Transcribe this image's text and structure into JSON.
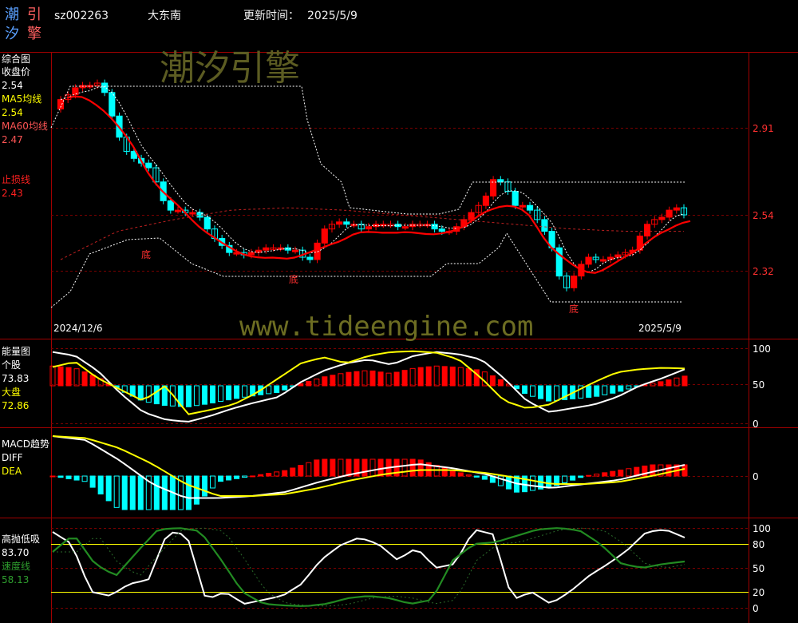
{
  "header": {
    "logo_chars": [
      "潮",
      "引",
      "汐",
      "擎"
    ],
    "code": "sz002263",
    "name": "大东南",
    "update_label": "更新时间：",
    "update_date": "2025/5/9"
  },
  "watermarks": {
    "brand": "潮汐引擎",
    "site": "www.tideengine.com"
  },
  "colors": {
    "up": "#ff0000",
    "down": "#00ffff",
    "ma5": "#ffff00",
    "ma60": "#ff0000",
    "grid": "#8b0000",
    "frame": "#a00000",
    "green": "#228b22"
  },
  "chart_data": [
    {
      "type": "candlestick",
      "title": "综合图",
      "legend": [
        {
          "label": "收盘价",
          "value": "2.54",
          "color": "#ffffff"
        },
        {
          "label": "MA5均线",
          "value": "2.54",
          "color": "#ffff00"
        },
        {
          "label": "MA60均线",
          "value": "2.47",
          "color": "#ff5555"
        },
        {
          "label": "止损线",
          "value": "2.43",
          "color": "#ff2020"
        }
      ],
      "y_ticks": [
        2.91,
        2.54,
        2.32
      ],
      "x_labels": {
        "start": "2024/12/6",
        "end": "2025/5/9"
      },
      "annotations": [
        "底",
        "底",
        "底"
      ],
      "ohlc_close": [
        3.03,
        3.05,
        3.08,
        3.09,
        3.09,
        3.1,
        3.06,
        2.96,
        2.87,
        2.81,
        2.78,
        2.76,
        2.74,
        2.68,
        2.6,
        2.56,
        2.56,
        2.55,
        2.55,
        2.53,
        2.48,
        2.44,
        2.41,
        2.38,
        2.38,
        2.37,
        2.38,
        2.39,
        2.4,
        2.4,
        2.4,
        2.39,
        2.39,
        2.36,
        2.35,
        2.42,
        2.48,
        2.5,
        2.51,
        2.5,
        2.5,
        2.48,
        2.49,
        2.5,
        2.5,
        2.5,
        2.49,
        2.49,
        2.5,
        2.5,
        2.5,
        2.48,
        2.47,
        2.47,
        2.49,
        2.52,
        2.55,
        2.58,
        2.62,
        2.69,
        2.68,
        2.64,
        2.58,
        2.58,
        2.56,
        2.52,
        2.47,
        2.4,
        2.28,
        2.23,
        2.28,
        2.33,
        2.36,
        2.35,
        2.35,
        2.36,
        2.37,
        2.38,
        2.39,
        2.45,
        2.5,
        2.52,
        2.53,
        2.56,
        2.57,
        2.54
      ]
    },
    {
      "type": "line",
      "title": "能量图",
      "series": [
        {
          "name": "个股",
          "value": "73.83",
          "color": "#ffffff"
        },
        {
          "name": "大盘",
          "value": "72.86",
          "color": "#ffff00"
        }
      ],
      "y_ticks": [
        100,
        50,
        0
      ]
    },
    {
      "type": "line",
      "title": "MACD趋势",
      "series": [
        {
          "name": "DIFF",
          "color": "#ffffff"
        },
        {
          "name": "DEA",
          "color": "#ffff00"
        }
      ],
      "y_ticks": [
        0
      ]
    },
    {
      "type": "line",
      "title": "高抛低吸",
      "series": [
        {
          "name": "",
          "value": "83.70",
          "color": "#ffffff"
        },
        {
          "name": "速度线",
          "value": "58.13",
          "color": "#228b22"
        }
      ],
      "y_ticks": [
        100,
        80,
        50,
        20,
        0
      ]
    }
  ]
}
